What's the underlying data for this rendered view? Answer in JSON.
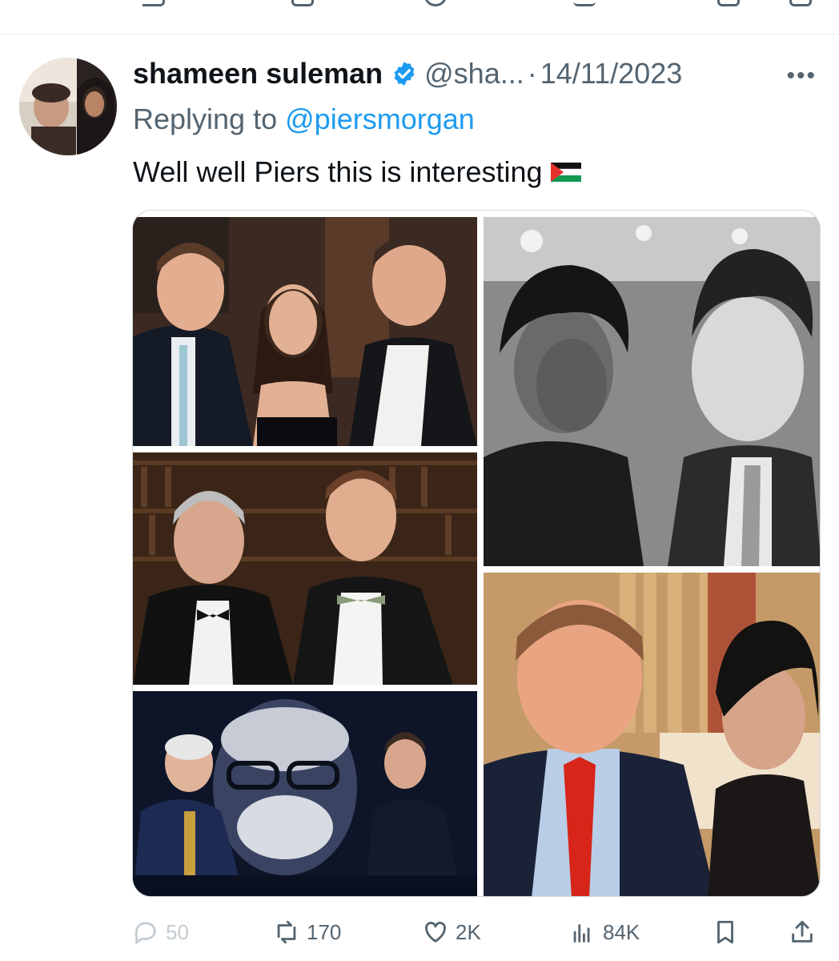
{
  "tweet": {
    "author_name": "shameen suleman",
    "handle": "@sha...",
    "separator": "·",
    "date": "14/11/2023",
    "more_label": "•••",
    "replying_prefix": "Replying to",
    "replying_mention": "@piersmorgan",
    "text": "Well well Piers this is interesting",
    "flag": "palestine-flag-icon"
  },
  "actions": {
    "replies": "50",
    "reposts": "170",
    "likes": "2K",
    "views": "84K"
  },
  "colors": {
    "accent": "#1d9bf0",
    "text_secondary": "#536471",
    "verified": "#1d9bf0"
  },
  "media": {
    "images": [
      "photo-top-left",
      "photo-top-right",
      "photo-middle-left",
      "photo-bottom-left",
      "photo-bottom-right"
    ]
  }
}
